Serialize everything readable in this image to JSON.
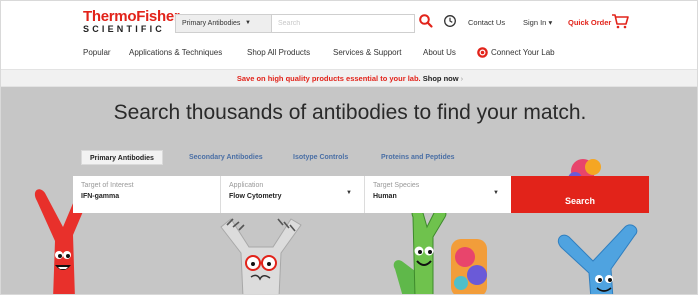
{
  "brand": {
    "logo_top": "ThermoFisher",
    "logo_bottom": "SCIENTIFIC",
    "primary_color": "#e2231a"
  },
  "header": {
    "search_category": "Primary Antibodies",
    "search_placeholder": "Search",
    "contact": "Contact Us",
    "sign_in": "Sign In",
    "quick_order": "Quick Order",
    "icons": [
      "search-icon",
      "history-icon",
      "chevron-down-icon",
      "cart-icon"
    ]
  },
  "nav": {
    "items": [
      {
        "label": "Popular"
      },
      {
        "label": "Applications & Techniques"
      },
      {
        "label": "Shop All Products"
      },
      {
        "label": "Services & Support"
      },
      {
        "label": "About Us"
      },
      {
        "label": "Connect Your Lab"
      }
    ]
  },
  "promo": {
    "text_red": "Save on high quality products essential to your lab.",
    "text_link": "Shop now"
  },
  "hero": {
    "title": "Search thousands of antibodies to find your match.",
    "background": "#c6c6c6",
    "tabs": [
      {
        "label": "Primary Antibodies",
        "active": true
      },
      {
        "label": "Secondary Antibodies",
        "active": false
      },
      {
        "label": "Isotype Controls",
        "active": false
      },
      {
        "label": "Proteins and Peptides",
        "active": false
      }
    ],
    "form": {
      "target_label": "Target of Interest",
      "target_value": "IFN-gamma",
      "application_label": "Application",
      "application_value": "Flow Cytometry",
      "species_label": "Target Species",
      "species_value": "Human",
      "search_button": "Search"
    },
    "mascots": [
      "red-antibody-mascot",
      "glasses-mascot",
      "green-antibody-mascot",
      "tie-dye-antibody-mascot",
      "blue-antibody-mascot"
    ]
  }
}
